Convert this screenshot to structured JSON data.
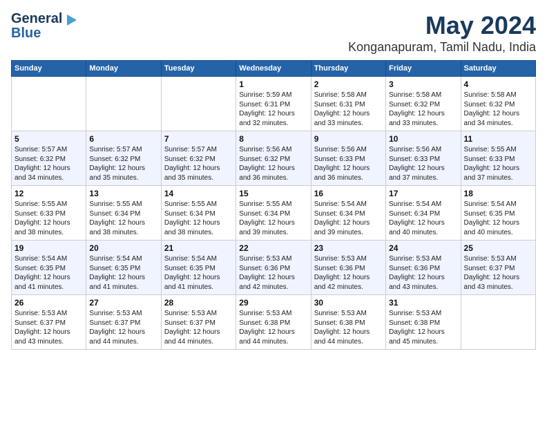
{
  "logo": {
    "line1": "General",
    "line2": "Blue"
  },
  "title": "May 2024",
  "subtitle": "Konganapuram, Tamil Nadu, India",
  "weekdays": [
    "Sunday",
    "Monday",
    "Tuesday",
    "Wednesday",
    "Thursday",
    "Friday",
    "Saturday"
  ],
  "weeks": [
    [
      {
        "day": "",
        "info": ""
      },
      {
        "day": "",
        "info": ""
      },
      {
        "day": "",
        "info": ""
      },
      {
        "day": "1",
        "info": "Sunrise: 5:59 AM\nSunset: 6:31 PM\nDaylight: 12 hours\nand 32 minutes."
      },
      {
        "day": "2",
        "info": "Sunrise: 5:58 AM\nSunset: 6:31 PM\nDaylight: 12 hours\nand 33 minutes."
      },
      {
        "day": "3",
        "info": "Sunrise: 5:58 AM\nSunset: 6:32 PM\nDaylight: 12 hours\nand 33 minutes."
      },
      {
        "day": "4",
        "info": "Sunrise: 5:58 AM\nSunset: 6:32 PM\nDaylight: 12 hours\nand 34 minutes."
      }
    ],
    [
      {
        "day": "5",
        "info": "Sunrise: 5:57 AM\nSunset: 6:32 PM\nDaylight: 12 hours\nand 34 minutes."
      },
      {
        "day": "6",
        "info": "Sunrise: 5:57 AM\nSunset: 6:32 PM\nDaylight: 12 hours\nand 35 minutes."
      },
      {
        "day": "7",
        "info": "Sunrise: 5:57 AM\nSunset: 6:32 PM\nDaylight: 12 hours\nand 35 minutes."
      },
      {
        "day": "8",
        "info": "Sunrise: 5:56 AM\nSunset: 6:32 PM\nDaylight: 12 hours\nand 36 minutes."
      },
      {
        "day": "9",
        "info": "Sunrise: 5:56 AM\nSunset: 6:33 PM\nDaylight: 12 hours\nand 36 minutes."
      },
      {
        "day": "10",
        "info": "Sunrise: 5:56 AM\nSunset: 6:33 PM\nDaylight: 12 hours\nand 37 minutes."
      },
      {
        "day": "11",
        "info": "Sunrise: 5:55 AM\nSunset: 6:33 PM\nDaylight: 12 hours\nand 37 minutes."
      }
    ],
    [
      {
        "day": "12",
        "info": "Sunrise: 5:55 AM\nSunset: 6:33 PM\nDaylight: 12 hours\nand 38 minutes."
      },
      {
        "day": "13",
        "info": "Sunrise: 5:55 AM\nSunset: 6:34 PM\nDaylight: 12 hours\nand 38 minutes."
      },
      {
        "day": "14",
        "info": "Sunrise: 5:55 AM\nSunset: 6:34 PM\nDaylight: 12 hours\nand 38 minutes."
      },
      {
        "day": "15",
        "info": "Sunrise: 5:55 AM\nSunset: 6:34 PM\nDaylight: 12 hours\nand 39 minutes."
      },
      {
        "day": "16",
        "info": "Sunrise: 5:54 AM\nSunset: 6:34 PM\nDaylight: 12 hours\nand 39 minutes."
      },
      {
        "day": "17",
        "info": "Sunrise: 5:54 AM\nSunset: 6:34 PM\nDaylight: 12 hours\nand 40 minutes."
      },
      {
        "day": "18",
        "info": "Sunrise: 5:54 AM\nSunset: 6:35 PM\nDaylight: 12 hours\nand 40 minutes."
      }
    ],
    [
      {
        "day": "19",
        "info": "Sunrise: 5:54 AM\nSunset: 6:35 PM\nDaylight: 12 hours\nand 41 minutes."
      },
      {
        "day": "20",
        "info": "Sunrise: 5:54 AM\nSunset: 6:35 PM\nDaylight: 12 hours\nand 41 minutes."
      },
      {
        "day": "21",
        "info": "Sunrise: 5:54 AM\nSunset: 6:35 PM\nDaylight: 12 hours\nand 41 minutes."
      },
      {
        "day": "22",
        "info": "Sunrise: 5:53 AM\nSunset: 6:36 PM\nDaylight: 12 hours\nand 42 minutes."
      },
      {
        "day": "23",
        "info": "Sunrise: 5:53 AM\nSunset: 6:36 PM\nDaylight: 12 hours\nand 42 minutes."
      },
      {
        "day": "24",
        "info": "Sunrise: 5:53 AM\nSunset: 6:36 PM\nDaylight: 12 hours\nand 43 minutes."
      },
      {
        "day": "25",
        "info": "Sunrise: 5:53 AM\nSunset: 6:37 PM\nDaylight: 12 hours\nand 43 minutes."
      }
    ],
    [
      {
        "day": "26",
        "info": "Sunrise: 5:53 AM\nSunset: 6:37 PM\nDaylight: 12 hours\nand 43 minutes."
      },
      {
        "day": "27",
        "info": "Sunrise: 5:53 AM\nSunset: 6:37 PM\nDaylight: 12 hours\nand 44 minutes."
      },
      {
        "day": "28",
        "info": "Sunrise: 5:53 AM\nSunset: 6:37 PM\nDaylight: 12 hours\nand 44 minutes."
      },
      {
        "day": "29",
        "info": "Sunrise: 5:53 AM\nSunset: 6:38 PM\nDaylight: 12 hours\nand 44 minutes."
      },
      {
        "day": "30",
        "info": "Sunrise: 5:53 AM\nSunset: 6:38 PM\nDaylight: 12 hours\nand 44 minutes."
      },
      {
        "day": "31",
        "info": "Sunrise: 5:53 AM\nSunset: 6:38 PM\nDaylight: 12 hours\nand 45 minutes."
      },
      {
        "day": "",
        "info": ""
      }
    ]
  ]
}
